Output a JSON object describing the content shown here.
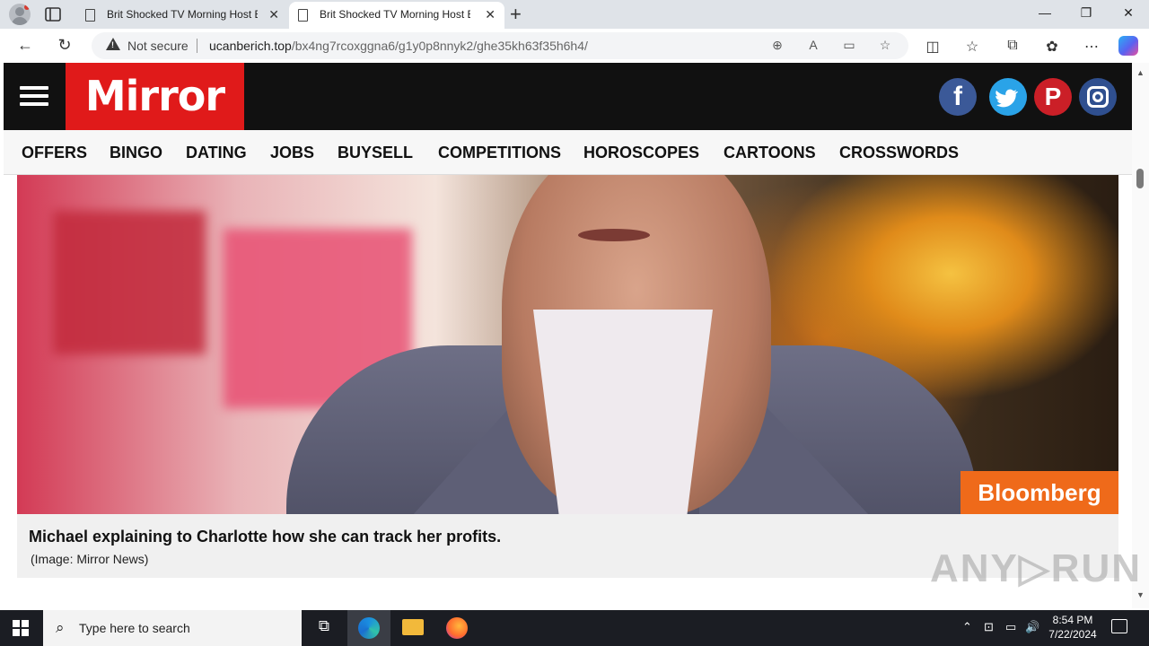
{
  "browser": {
    "tabs": [
      {
        "title": "Brit Shocked TV Morning Host By",
        "close": "✕"
      },
      {
        "title": "Brit Shocked TV Morning Host By",
        "close": "✕"
      }
    ],
    "new_tab": "+",
    "window_controls": {
      "minimize": "—",
      "restore": "❐",
      "close": "✕"
    },
    "security_label": "Not secure",
    "url_host": "ucanberich.top",
    "url_path": "/bx4ng7rcoxggna6/g1y0p8nnyk2/ghe35kh63f35h6h4/",
    "icons": [
      "back-icon",
      "refresh-icon",
      "zoom-icon",
      "read-aloud-icon",
      "immersive-reader-icon",
      "favorite-star-icon",
      "split-screen-icon",
      "favorites-icon",
      "collections-icon",
      "extensions-icon",
      "more-icon",
      "copilot-icon"
    ]
  },
  "site": {
    "logo": "Mirror",
    "social": {
      "facebook": "f",
      "twitter": "🐦",
      "pinterest": "P"
    },
    "menu": [
      "OFFERS",
      "BINGO",
      "DATING",
      "JOBS",
      "BUYSELL",
      "COMPETITIONS",
      "HOROSCOPES",
      "CARTOONS",
      "CROSSWORDS"
    ],
    "hero": {
      "overlay_badge": "Bloomberg"
    },
    "caption": {
      "main": "Michael explaining to Charlotte how she can track her profits.",
      "credit": "(Image: Mirror News)"
    }
  },
  "watermark": "ANY▷RUN",
  "taskbar": {
    "search_placeholder": "Type here to search",
    "time": "8:54 PM",
    "date": "7/22/2024"
  }
}
